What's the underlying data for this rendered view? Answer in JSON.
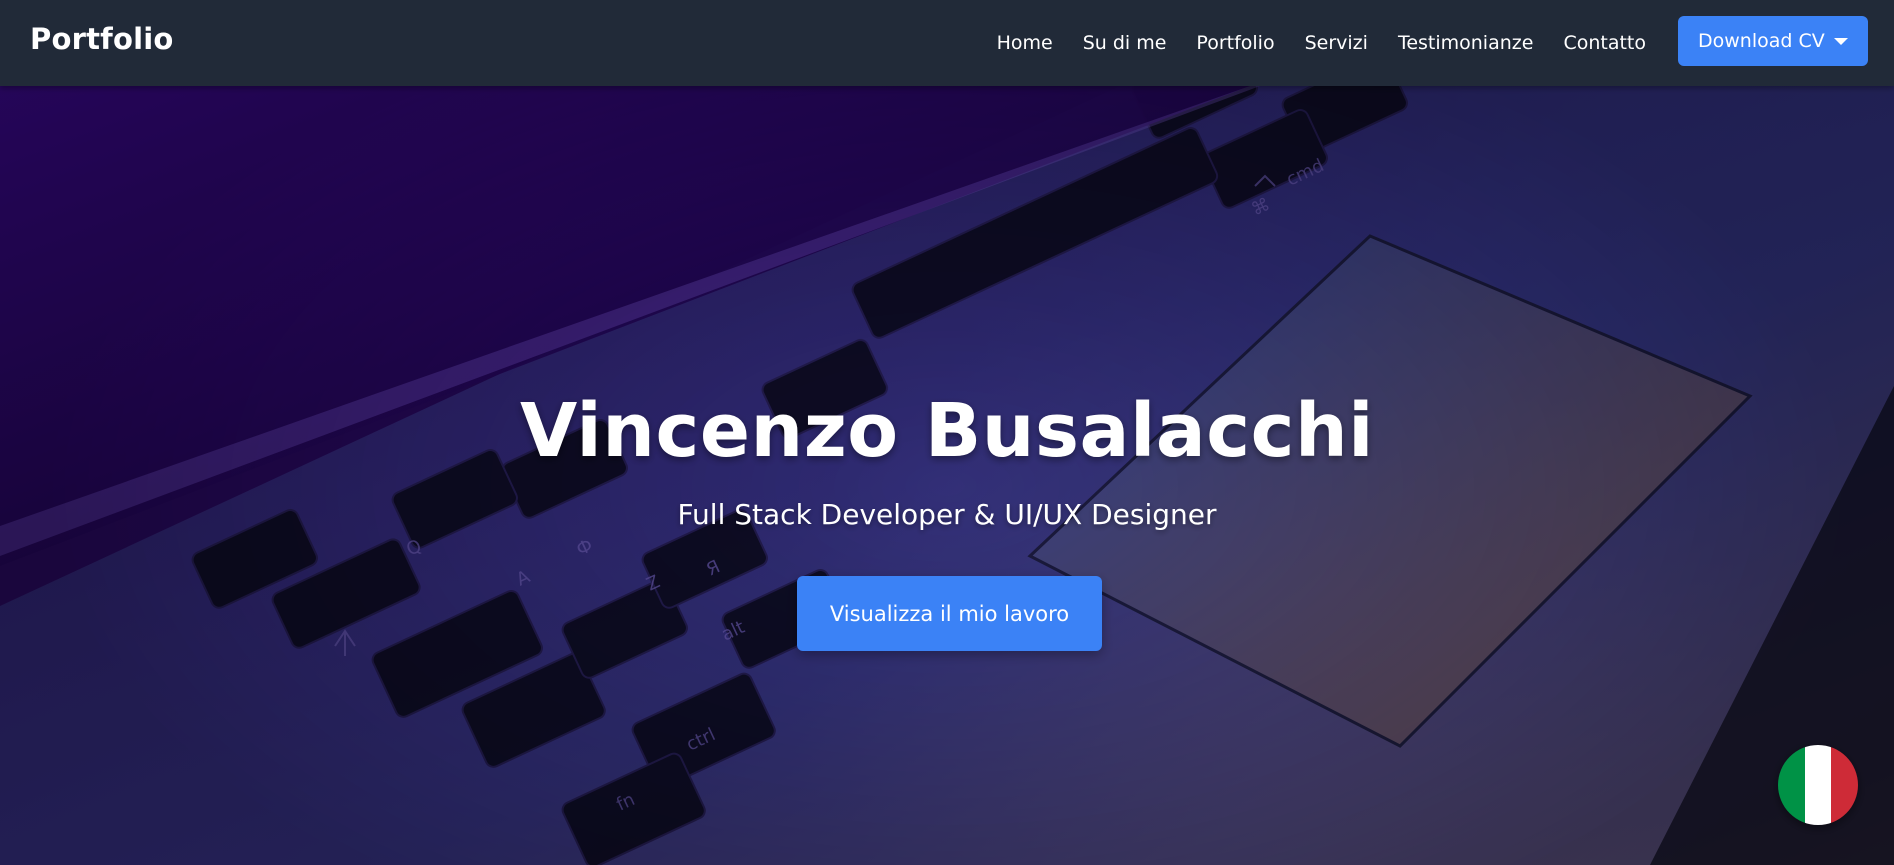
{
  "navbar": {
    "brand": "Portfolio",
    "links": [
      "Home",
      "Su di me",
      "Portfolio",
      "Servizi",
      "Testimonianze",
      "Contatto"
    ],
    "download_label": "Download CV"
  },
  "hero": {
    "title": "Vincenzo Busalacchi",
    "subtitle": "Full Stack Developer & UI/UX Designer",
    "cta_label": "Visualizza il mio lavoro"
  },
  "language_switcher": {
    "flag": "italy-flag-icon",
    "colors": [
      "#009246",
      "#ffffff",
      "#ce2b37"
    ]
  },
  "colors": {
    "navbar_bg": "#212a38",
    "accent": "#3b82f6",
    "text": "#ffffff"
  },
  "keyboard_keys": [
    "cmd",
    "⌘",
    "alt",
    "ctrl",
    "fn",
    "Q",
    "A",
    "Z",
    "Я",
    "Ф"
  ]
}
